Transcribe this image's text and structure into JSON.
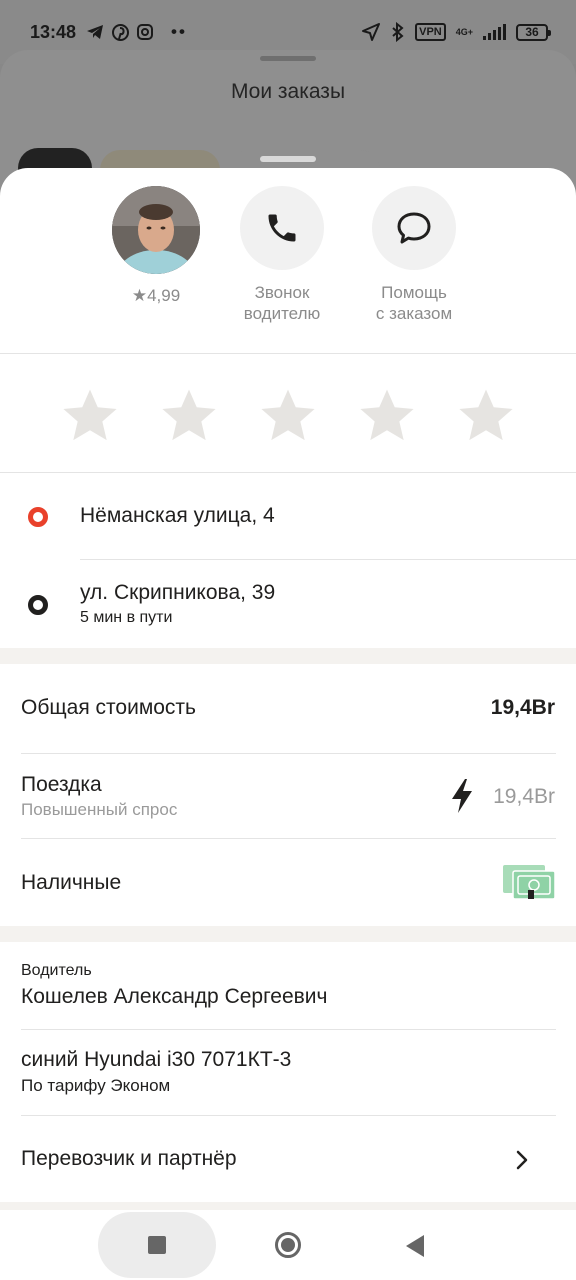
{
  "status_bar": {
    "time": "13:48",
    "network": "4G+",
    "vpn": "VPN",
    "battery": "36"
  },
  "background": {
    "title": "Мои заказы"
  },
  "driver_actions": {
    "rating": "4,99",
    "call_label": "Звонок\nводителю",
    "help_label": "Помощь\nс заказом"
  },
  "rating_stars": {
    "count": 5,
    "selected": 0
  },
  "route": {
    "from": "Нёманская улица, 4",
    "to": "ул. Скрипникова, 39",
    "duration": "5 мин в пути",
    "from_color": "#e9412b",
    "to_color": "#21201f"
  },
  "cost": {
    "total_label": "Общая стоимость",
    "total_value": "19,4Br",
    "trip_label": "Поездка",
    "trip_sub": "Повышенный спрос",
    "trip_value": "19,4Br",
    "payment_label": "Наличные"
  },
  "driver": {
    "caption": "Водитель",
    "name": "Кошелев Александр Сергеевич",
    "car": "синий Hyundai i30 7071КТ-3",
    "tariff": "По тарифу Эконом",
    "partner_label": "Перевозчик и партнёр"
  }
}
